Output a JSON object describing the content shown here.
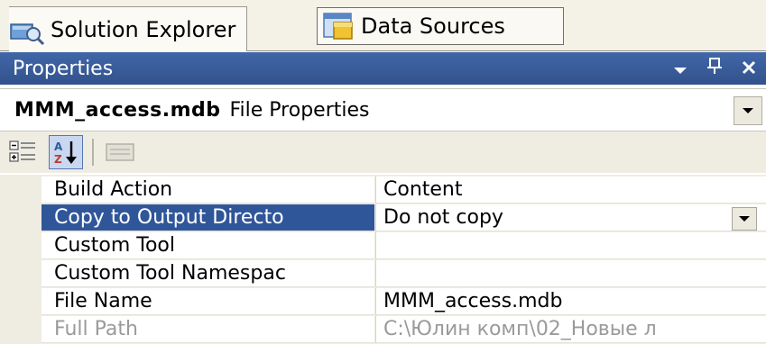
{
  "tabs": [
    {
      "label": "Solution Explorer",
      "icon": "solution-explorer-icon",
      "active": true
    },
    {
      "label": "Data Sources",
      "icon": "data-sources-icon",
      "active": false
    }
  ],
  "panel": {
    "title": "Properties",
    "buttons": {
      "pin_down": "▾",
      "auto_hide": "ᴨ",
      "close": "✕"
    }
  },
  "object": {
    "name": "MMM_access.mdb",
    "type": "File Properties"
  },
  "toolbar": {
    "categorized_icon": "categorized-icon",
    "alphabetical_icon": "alphabetical-sort-icon",
    "property_pages_icon": "property-pages-icon"
  },
  "properties": [
    {
      "name": "Build Action",
      "value": "Content"
    },
    {
      "name": "Copy to Output Directo",
      "value": "Do not copy"
    },
    {
      "name": "Custom Tool",
      "value": ""
    },
    {
      "name": "Custom Tool Namespac",
      "value": ""
    },
    {
      "name": "File Name",
      "value": "MMM_access.mdb"
    },
    {
      "name": "Full Path",
      "value": "C:\\Юлин комп\\02_Новые л"
    }
  ],
  "colors": {
    "title_bar": "#385894",
    "selection": "#30569a",
    "chrome": "#efede2"
  }
}
